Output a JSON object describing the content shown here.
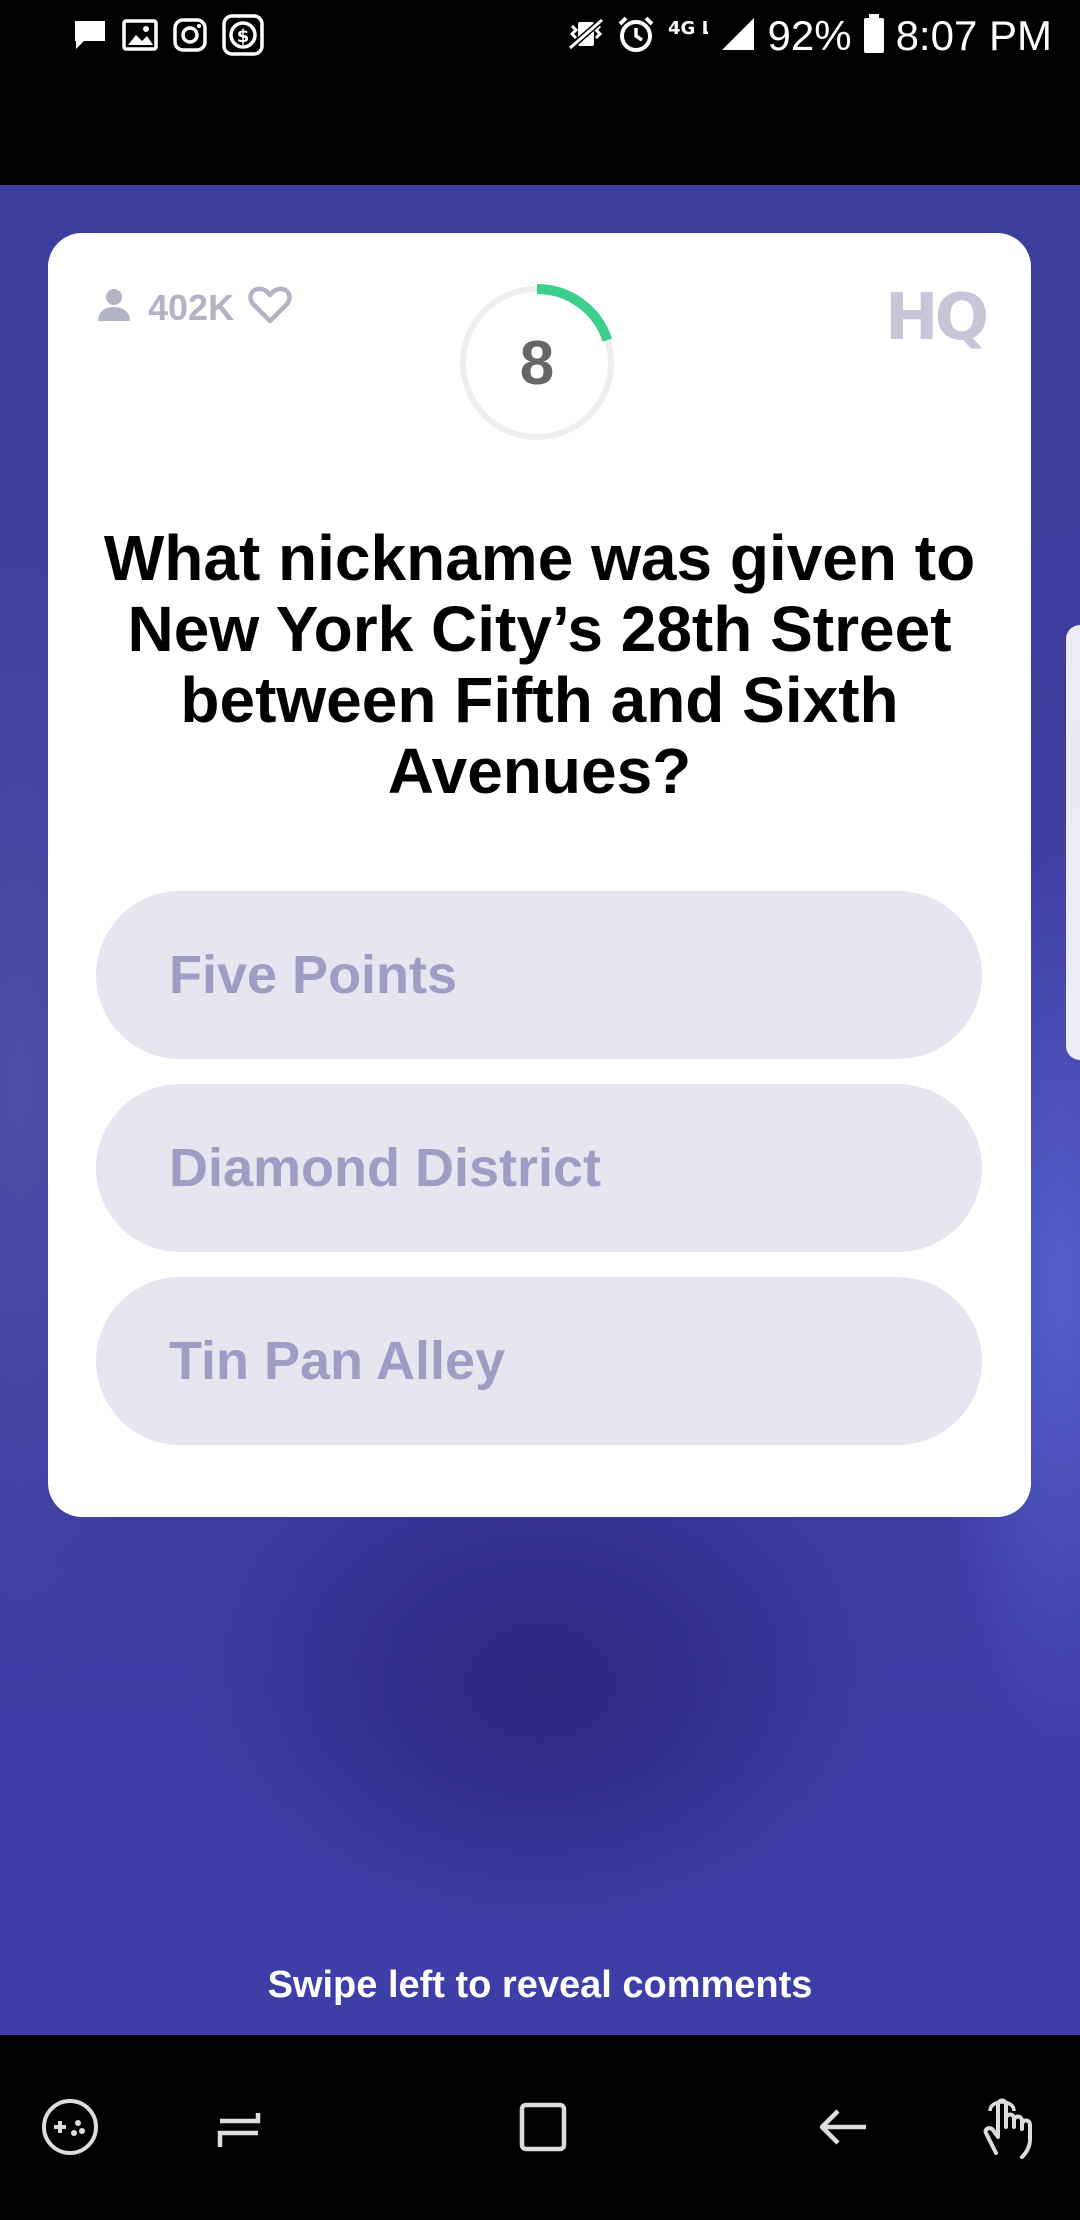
{
  "status_bar": {
    "battery": "92%",
    "time": "8:07 PM",
    "network": "4G LTE",
    "left_icons": [
      "message-icon",
      "image-icon",
      "instagram-icon",
      "cash-icon"
    ],
    "right_icons": [
      "vibrate-icon",
      "alarm-icon",
      "network-4g-icon",
      "signal-icon",
      "battery-icon"
    ]
  },
  "card": {
    "viewer_count": "402K",
    "timer_value": "8",
    "timer_progress": 0.2,
    "logo": "HQ",
    "question": "What nickname was given to New York City’s 28th Street between Fifth and Sixth Avenues?",
    "answers": [
      {
        "label": "Five Points"
      },
      {
        "label": "Diamond District"
      },
      {
        "label": "Tin Pan Alley"
      }
    ]
  },
  "swipe_hint": "Swipe left to reveal comments",
  "nav_bar": {
    "buttons": [
      "game-tools-icon",
      "recents-icon",
      "home-icon",
      "back-icon",
      "touch-icon"
    ]
  },
  "colors": {
    "timer_arc": "#3ecf8e",
    "answer_bg": "#e6e5f0",
    "answer_text": "#9e9dc3",
    "background": "#3c3f9e"
  }
}
